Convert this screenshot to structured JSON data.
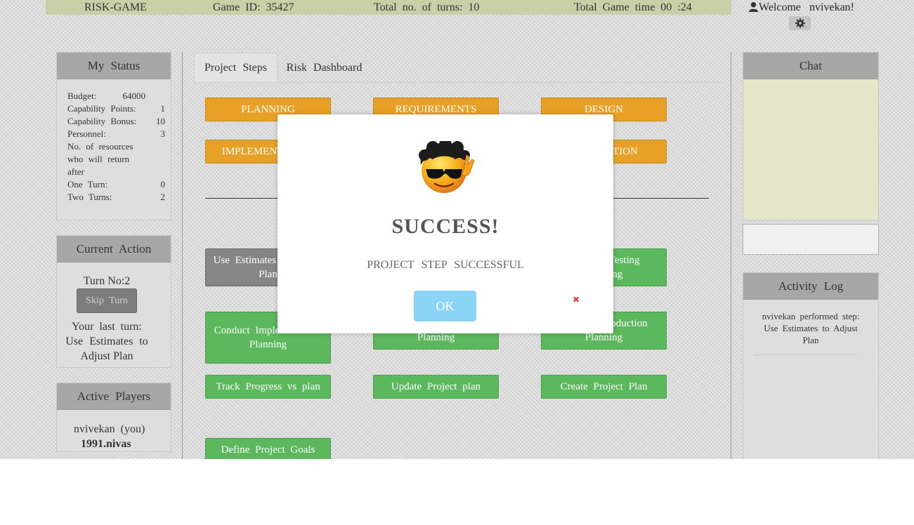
{
  "topbar": {
    "app_name": "RISK-GAME",
    "game_id": "Game ID: 35427",
    "turns": "Total no. of turns: 10",
    "game_time": "Total Game time 00 :24"
  },
  "user": {
    "welcome": "Welcome nvivekan!"
  },
  "my_status": {
    "title": "My Status",
    "budget_label": "Budget:",
    "budget_value": "64000",
    "cap_points_label": "Capability Points:",
    "cap_points_value": "1",
    "cap_bonus_label": "Capability Bonus:",
    "cap_bonus_value": "10",
    "personnel_label": "Personnel:",
    "personnel_value": "3",
    "resources_line1": "No. of resources",
    "resources_line2": "who will return",
    "resources_line3": "after",
    "one_turn_label": "One Turn:",
    "one_turn_value": "0",
    "two_turns_label": "Two Turns:",
    "two_turns_value": "2"
  },
  "current_action": {
    "title": "Current Action",
    "turn": "Turn No:2",
    "skip_label": "Skip Turn",
    "last_turn_label": "Your last turn:",
    "last_turn_value_1": "Use Estimates to",
    "last_turn_value_2": "Adjust Plan"
  },
  "active_players": {
    "title": "Active Players",
    "players": [
      "nvivekan (you)",
      "1991.nivas"
    ]
  },
  "tabs": [
    "Project Steps",
    "Risk Dashboard"
  ],
  "phases": {
    "planning": "PLANNING",
    "requirements": "REQUIREMENTS",
    "design": "DESIGN",
    "implementation": "IMPLEMENTATION",
    "production": "PRODUCTION"
  },
  "steps": {
    "use_estimates": "Use Estimates to Adjust Plan",
    "conduct_testing": "Conduct Testing Planning",
    "conduct_impl": "Conduct Implementation Planning",
    "conduct_middle": "Conduct Design Planning",
    "conduct_production": "Conduct Production Planning",
    "track_progress": "Track Progress vs plan",
    "update_plan": "Update Project plan",
    "create_plan": "Create Project Plan",
    "define_goals": "Define Project Goals"
  },
  "chat": {
    "title": "Chat"
  },
  "activity_log": {
    "title": "Activity Log",
    "entries": [
      "nvivekan performed step: Use Estimates to Adjust Plan"
    ]
  },
  "modal": {
    "title": "SUCCESS!",
    "message": "PROJECT STEP SUCCESSFUL",
    "ok_label": "OK",
    "close_glyph": "✖"
  },
  "colors": {
    "topbar": "#c9cfa6",
    "orange": "#e7a127",
    "green": "#5cb85c",
    "grey_btn": "#868686",
    "ok": "#8cd4f5",
    "close": "#e8443a"
  }
}
